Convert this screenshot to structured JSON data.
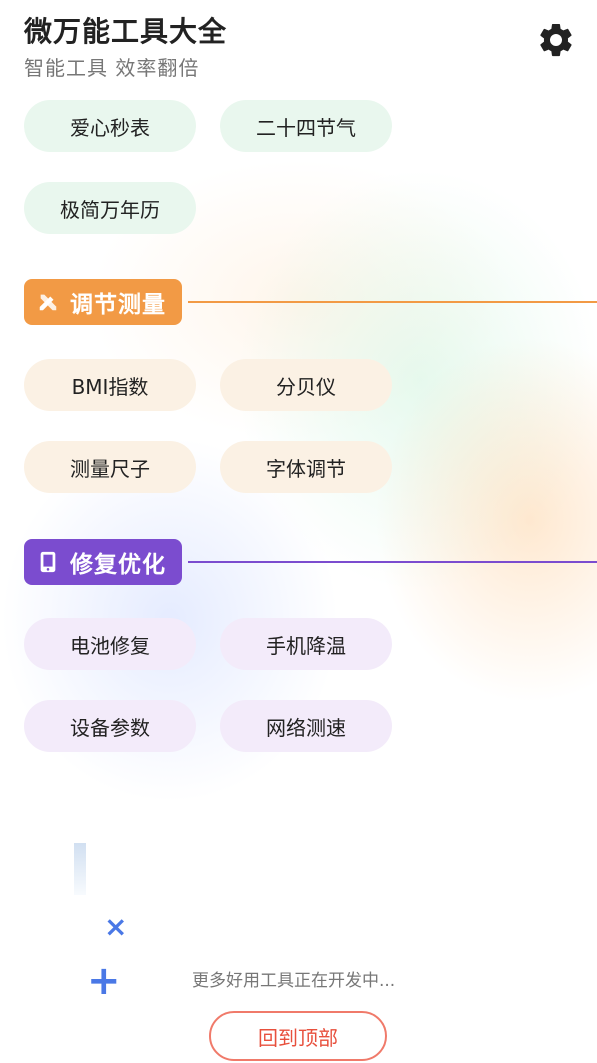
{
  "header": {
    "title": "微万能工具大全",
    "subtitle": "智能工具 效率翻倍",
    "settings_icon": "gear-icon"
  },
  "colors": {
    "green_chip": "#e9f7ee",
    "orange_accent": "#f29a45",
    "orange_chip": "#fbf1e4",
    "purple_accent": "#7b4ccf",
    "purple_chip": "#f3ebfa",
    "back_top_border": "#f07a6a"
  },
  "top_tools": [
    {
      "label": "爱心秒表"
    },
    {
      "label": "二十四节气"
    },
    {
      "label": "极简万年历"
    }
  ],
  "sections": [
    {
      "title": "调节测量",
      "icon": "ruler-pencil-icon",
      "tools": [
        {
          "label": "BMI指数"
        },
        {
          "label": "分贝仪"
        },
        {
          "label": "测量尺子"
        },
        {
          "label": "字体调节"
        }
      ]
    },
    {
      "title": "修复优化",
      "icon": "phone-icon",
      "tools": [
        {
          "label": "电池修复"
        },
        {
          "label": "手机降温"
        },
        {
          "label": "设备参数"
        },
        {
          "label": "网络测速"
        }
      ]
    }
  ],
  "footer": {
    "note": "更多好用工具正在开发中...",
    "back_to_top": "回到顶部",
    "deco_x": "×",
    "deco_plus": "+"
  }
}
